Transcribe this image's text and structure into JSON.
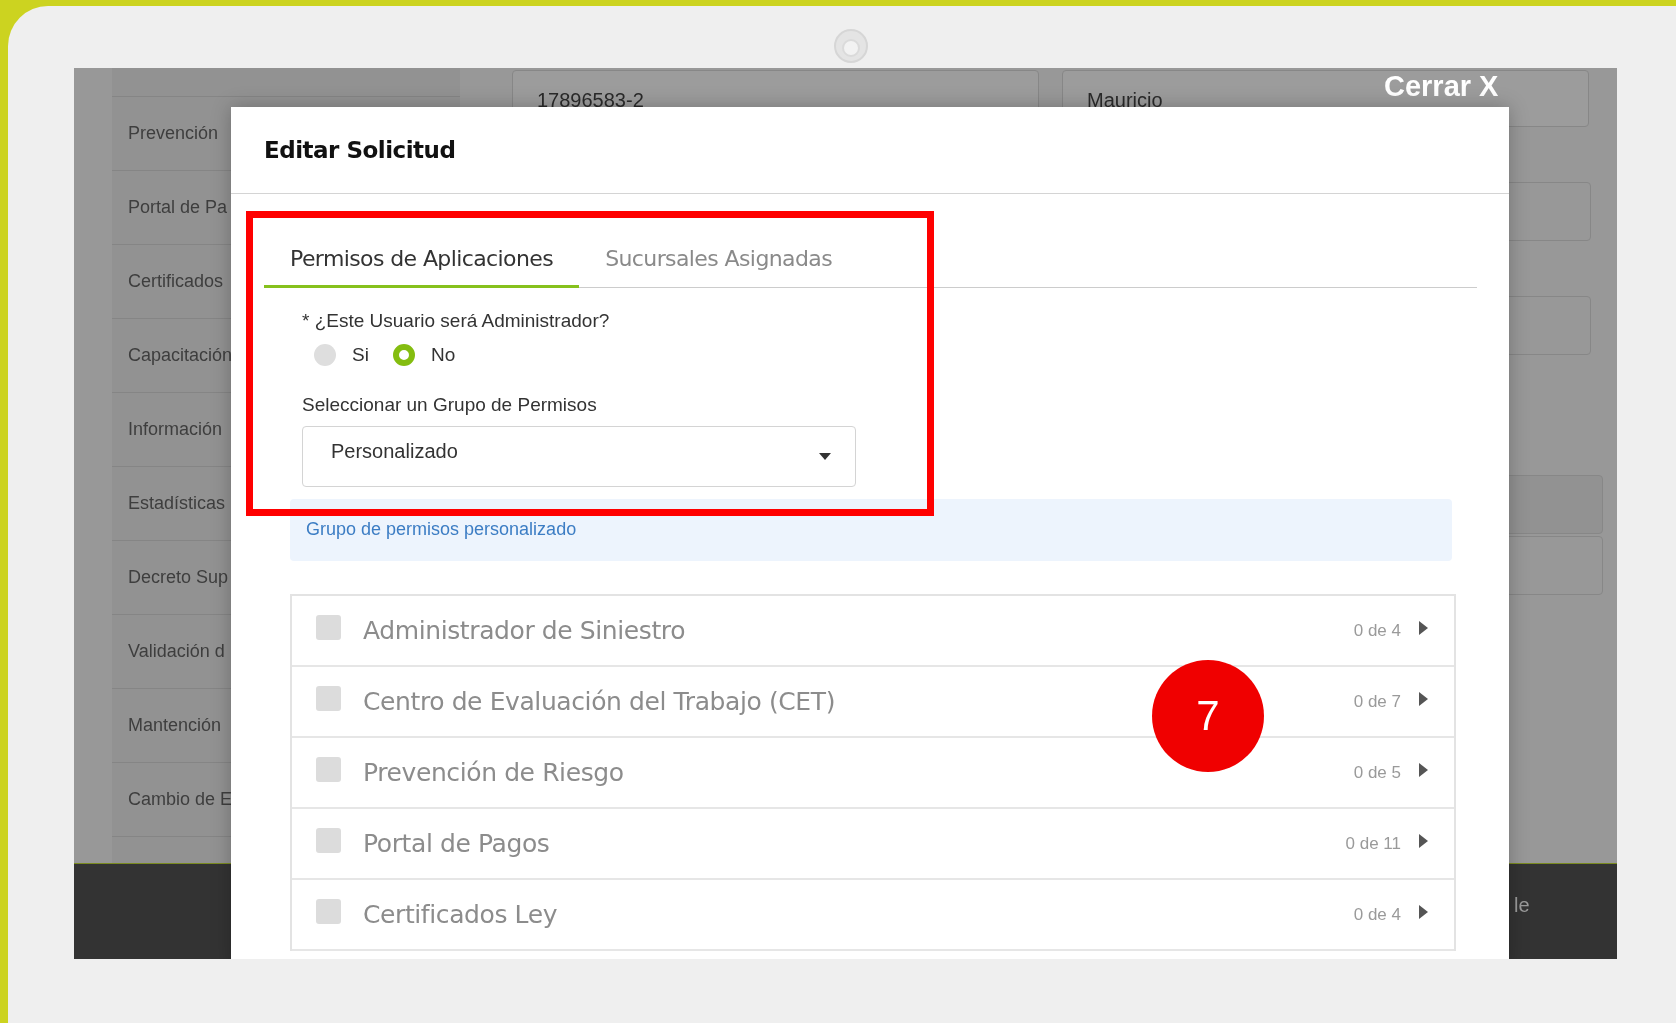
{
  "background_page": {
    "sidebar_items": [
      "Prevención",
      "Portal de Pa",
      "Certificados",
      "Capacitación",
      "Información",
      "Estadísticas",
      "Decreto Sup",
      "Validación d",
      "Mantención",
      "Cambio de E"
    ],
    "fields": [
      {
        "value": "17896583-2"
      },
      {
        "value": "Mauricio"
      }
    ],
    "footer_text": "le"
  },
  "close_button": "Cerrar X",
  "modal": {
    "title": "Editar Solicitud",
    "tabs": [
      {
        "label": "Permisos de Aplicaciones",
        "selected": true
      },
      {
        "label": "Sucursales Asignadas",
        "selected": false
      }
    ],
    "admin_question": {
      "label": "* ¿Este Usuario será Administrador?",
      "options": [
        {
          "label": "Si",
          "selected": false
        },
        {
          "label": "No",
          "selected": true
        }
      ]
    },
    "group_select": {
      "label": "Seleccionar un Grupo de Permisos",
      "value": "Personalizado"
    },
    "info_note": "Grupo de permisos personalizado",
    "permission_groups": [
      {
        "name": "Administrador de Siniestro",
        "checked": false,
        "count": "0 de 4"
      },
      {
        "name": "Centro de Evaluación del Trabajo (CET)",
        "checked": false,
        "count": "0 de 7"
      },
      {
        "name": "Prevención de Riesgo",
        "checked": false,
        "count": "0 de 5"
      },
      {
        "name": "Portal de Pagos",
        "checked": false,
        "count": "0 de 11"
      },
      {
        "name": "Certificados Ley",
        "checked": false,
        "count": "0 de 4"
      }
    ]
  },
  "step_badge": "7"
}
